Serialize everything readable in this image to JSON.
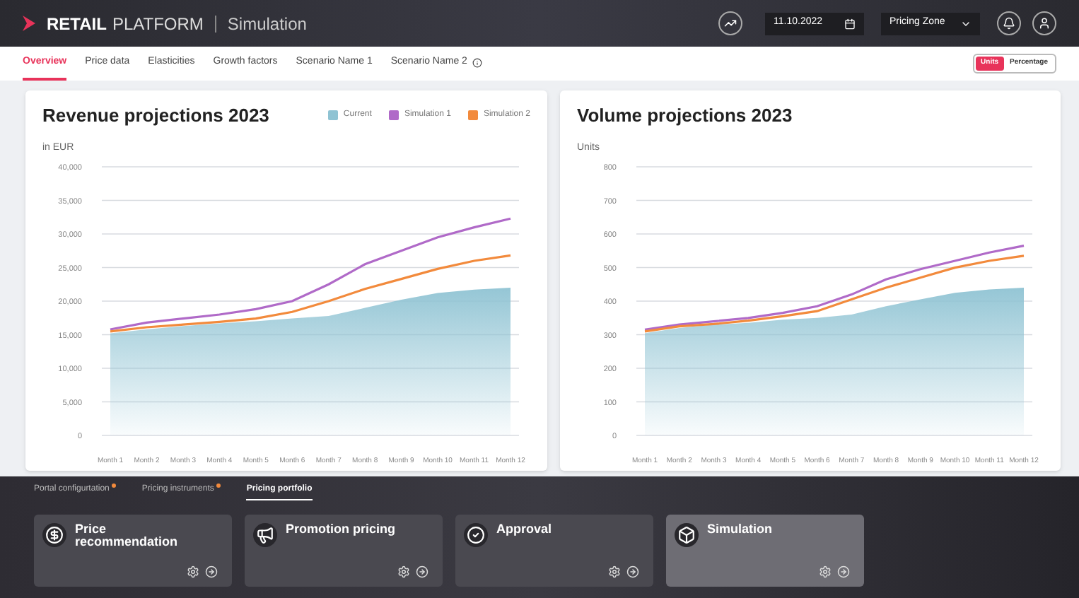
{
  "header": {
    "brand_bold": "RETAIL",
    "brand_light": "PLATFORM",
    "section": "Simulation",
    "date": "11.10.2022",
    "zone": "Pricing Zone"
  },
  "tabs": [
    {
      "label": "Overview",
      "selected": true,
      "info": false
    },
    {
      "label": "Price data",
      "selected": false,
      "info": false
    },
    {
      "label": "Elasticities",
      "selected": false,
      "info": false
    },
    {
      "label": "Growth factors",
      "selected": false,
      "info": false
    },
    {
      "label": "Scenario Name 1",
      "selected": false,
      "info": false
    },
    {
      "label": "Scenario Name 2",
      "selected": false,
      "info": true
    }
  ],
  "toggle": [
    {
      "label": "Units",
      "selected": true
    },
    {
      "label": "Percentage",
      "selected": false
    }
  ],
  "charts": [
    {
      "unit": "in EUR",
      "chart_data": {
        "type": "area",
        "title": "Revenue projections 2023",
        "categories": [
          "Month 1",
          "Month 2",
          "Month 3",
          "Month 4",
          "Month 5",
          "Month 6",
          "Month 7",
          "Month 8",
          "Month 9",
          "Month 10",
          "Month 11",
          "Month 12"
        ],
        "series": [
          {
            "name": "Current",
            "type": "area",
            "color": "#8fc3d3",
            "values": [
              15200,
              15800,
              16300,
              16700,
              17000,
              17400,
              17800,
              19000,
              20200,
              21200,
              21700,
              22000
            ]
          },
          {
            "name": "Simulation 1",
            "type": "line",
            "color": "#b06ac8",
            "values": [
              15800,
              16800,
              17400,
              18000,
              18800,
              20000,
              22500,
              25500,
              27500,
              29500,
              31000,
              32300
            ]
          },
          {
            "name": "Simulation 2",
            "type": "line",
            "color": "#f28a3c",
            "values": [
              15500,
              16100,
              16500,
              16900,
              17400,
              18400,
              20000,
              21800,
              23300,
              24800,
              26000,
              26800
            ]
          }
        ],
        "ylim": [
          0,
          40000
        ],
        "yticks": [
          {
            "value": 0,
            "label": "0"
          },
          {
            "value": 5000,
            "label": "5,000"
          },
          {
            "value": 10000,
            "label": "10,000"
          },
          {
            "value": 15000,
            "label": "15,000"
          },
          {
            "value": 20000,
            "label": "20,000"
          },
          {
            "value": 25000,
            "label": "25,000"
          },
          {
            "value": 30000,
            "label": "30,000"
          },
          {
            "value": 35000,
            "label": "35,000"
          },
          {
            "value": 40000,
            "label": "40,000"
          }
        ],
        "grid": true
      }
    },
    {
      "unit": "Units",
      "chart_data": {
        "type": "area",
        "title": "Volume projections 2023",
        "categories": [
          "Month 1",
          "Month 2",
          "Month 3",
          "Month 4",
          "Month 5",
          "Month 6",
          "Month 7",
          "Month 8",
          "Month 9",
          "Month 10",
          "Month 11",
          "Month 12"
        ],
        "series": [
          {
            "type": "area",
            "color": "#8fc3d3",
            "values": [
              305,
              320,
              330,
              335,
              345,
              350,
              360,
              385,
              405,
              425,
              435,
              440
            ]
          },
          {
            "type": "line",
            "color": "#b06ac8",
            "values": [
              315,
              330,
              340,
              350,
              365,
              385,
              420,
              465,
              495,
              520,
              545,
              565
            ]
          },
          {
            "type": "line",
            "color": "#f28a3c",
            "values": [
              310,
              325,
              332,
              342,
              355,
              370,
              405,
              440,
              470,
              500,
              520,
              535
            ]
          }
        ],
        "ylim": [
          0,
          800
        ],
        "yticks": [
          0,
          100,
          200,
          300,
          400,
          500,
          600,
          700,
          800
        ],
        "grid": true
      }
    }
  ],
  "bottom_tabs": [
    {
      "label": "Portal configurtation",
      "selected": false,
      "dot": true
    },
    {
      "label": "Pricing instruments",
      "selected": false,
      "dot": true
    },
    {
      "label": "Pricing portfolio",
      "selected": true,
      "dot": false
    }
  ],
  "modules": [
    {
      "kind": "price",
      "title": "Price recommendation",
      "selected": false
    },
    {
      "kind": "promotion",
      "title": "Promotion pricing",
      "selected": false
    },
    {
      "kind": "approval",
      "title": "Approval",
      "selected": false
    },
    {
      "kind": "simulation",
      "title": "Simulation",
      "selected": true
    }
  ]
}
